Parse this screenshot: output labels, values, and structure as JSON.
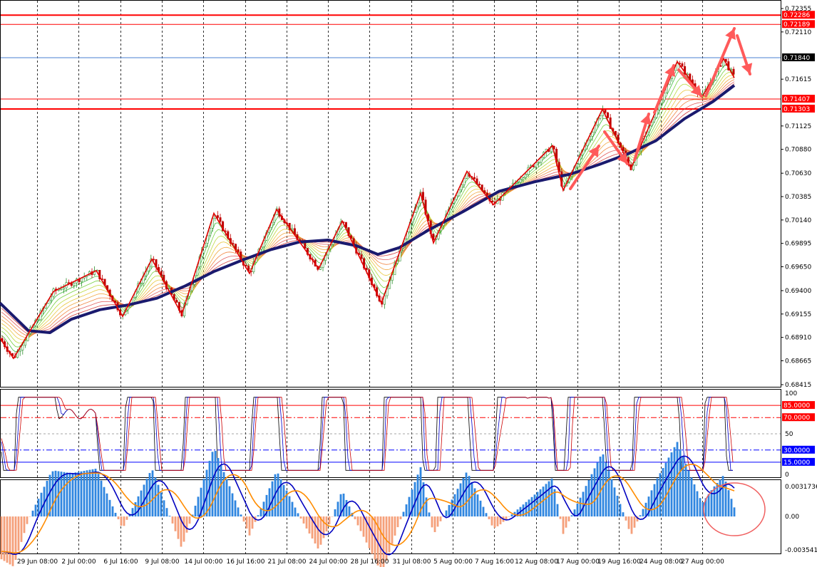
{
  "chart_data": [
    {
      "type": "candlestick",
      "name_hint": "price",
      "price_axis": {
        "range": [
          0.68415,
          0.72355
        ],
        "ticks": [
          "0.72355",
          "0.72110",
          "0.71615",
          "0.71125",
          "0.70880",
          "0.70630",
          "0.70385",
          "0.70140",
          "0.69895",
          "0.69650",
          "0.69400",
          "0.69155",
          "0.68910",
          "0.68665",
          "0.68415"
        ]
      },
      "horizontal_levels": [
        {
          "label": "0.72286",
          "value": 0.72286,
          "color": "#ff0000"
        },
        {
          "label": "0.72189",
          "value": 0.72189,
          "color": "#ff0000"
        },
        {
          "label": "0.71840",
          "value": 0.7184,
          "color": "#000000"
        },
        {
          "label": "0.71407",
          "value": 0.71407,
          "color": "#ff0000"
        },
        {
          "label": "0.71303",
          "value": 0.71303,
          "color": "#ff0000"
        }
      ],
      "zigzag": [
        [
          0,
          0.689
        ],
        [
          19,
          0.6869
        ],
        [
          75,
          0.6939
        ],
        [
          135,
          0.6961
        ],
        [
          172,
          0.6913
        ],
        [
          213,
          0.6973
        ],
        [
          255,
          0.6915
        ],
        [
          300,
          0.7021
        ],
        [
          350,
          0.6958
        ],
        [
          388,
          0.7025
        ],
        [
          447,
          0.6963
        ],
        [
          480,
          0.7013
        ],
        [
          535,
          0.6927
        ],
        [
          590,
          0.7042
        ],
        [
          608,
          0.699
        ],
        [
          655,
          0.7065
        ],
        [
          692,
          0.703
        ],
        [
          775,
          0.7092
        ],
        [
          790,
          0.7045
        ],
        [
          845,
          0.713
        ],
        [
          885,
          0.7068
        ],
        [
          950,
          0.718
        ],
        [
          985,
          0.7143
        ],
        [
          1015,
          0.7183
        ],
        [
          1030,
          0.7163
        ]
      ],
      "ma_trend": [
        [
          0,
          0.6927
        ],
        [
          40,
          0.6898
        ],
        [
          70,
          0.6896
        ],
        [
          100,
          0.691
        ],
        [
          140,
          0.692
        ],
        [
          180,
          0.6925
        ],
        [
          220,
          0.6932
        ],
        [
          260,
          0.6945
        ],
        [
          300,
          0.696
        ],
        [
          340,
          0.6972
        ],
        [
          380,
          0.6983
        ],
        [
          420,
          0.6991
        ],
        [
          460,
          0.6993
        ],
        [
          500,
          0.6987
        ],
        [
          530,
          0.6978
        ],
        [
          560,
          0.6985
        ],
        [
          600,
          0.7003
        ],
        [
          650,
          0.7023
        ],
        [
          700,
          0.7044
        ],
        [
          750,
          0.7054
        ],
        [
          800,
          0.7062
        ],
        [
          840,
          0.7072
        ],
        [
          880,
          0.7083
        ],
        [
          920,
          0.7097
        ],
        [
          960,
          0.712
        ],
        [
          1000,
          0.7138
        ],
        [
          1030,
          0.7155
        ]
      ]
    },
    {
      "type": "line",
      "name_hint": "oscillator",
      "y_axis": {
        "range": [
          0,
          100
        ],
        "ticks": [
          "100",
          "50",
          "0"
        ]
      },
      "levels": [
        {
          "label": "85.0000",
          "value": 85,
          "color": "#ff0000"
        },
        {
          "label": "70.0000",
          "value": 70,
          "color": "#ff0000"
        },
        {
          "label": "30.0000",
          "value": 30,
          "color": "#0000ff"
        },
        {
          "label": "15.0000",
          "value": 15,
          "color": "#0000ff"
        }
      ]
    },
    {
      "type": "bar",
      "name_hint": "macd",
      "y_axis": {
        "range": [
          -0.003541,
          0.003173
        ],
        "ticks": [
          "0.00317361",
          "0.00",
          "-0.003541"
        ]
      }
    }
  ],
  "time_axis": {
    "labels": [
      "29 Jun 08:00",
      "2 Jul 00:00",
      "6 Jul 16:00",
      "9 Jul 08:00",
      "14 Jul 00:00",
      "16 Jul 16:00",
      "21 Jul 08:00",
      "24 Jul 00:00",
      "28 Jul 16:00",
      "31 Jul 08:00",
      "5 Aug 00:00",
      "7 Aug 16:00",
      "12 Aug 08:00",
      "17 Aug 00:00",
      "19 Aug 16:00",
      "24 Aug 08:00",
      "27 Aug 00:00"
    ]
  },
  "colors": {
    "bull": "#2f8f2f",
    "bear": "#c00000",
    "zigzag": "#e00000",
    "trend_ma": "#1a1a6e",
    "arrows": "#ff5a5a",
    "hist_pos": "#2f86e0",
    "hist_neg": "#f5a07a",
    "macd_line": "#0000c0",
    "signal_line": "#ff8c00"
  }
}
